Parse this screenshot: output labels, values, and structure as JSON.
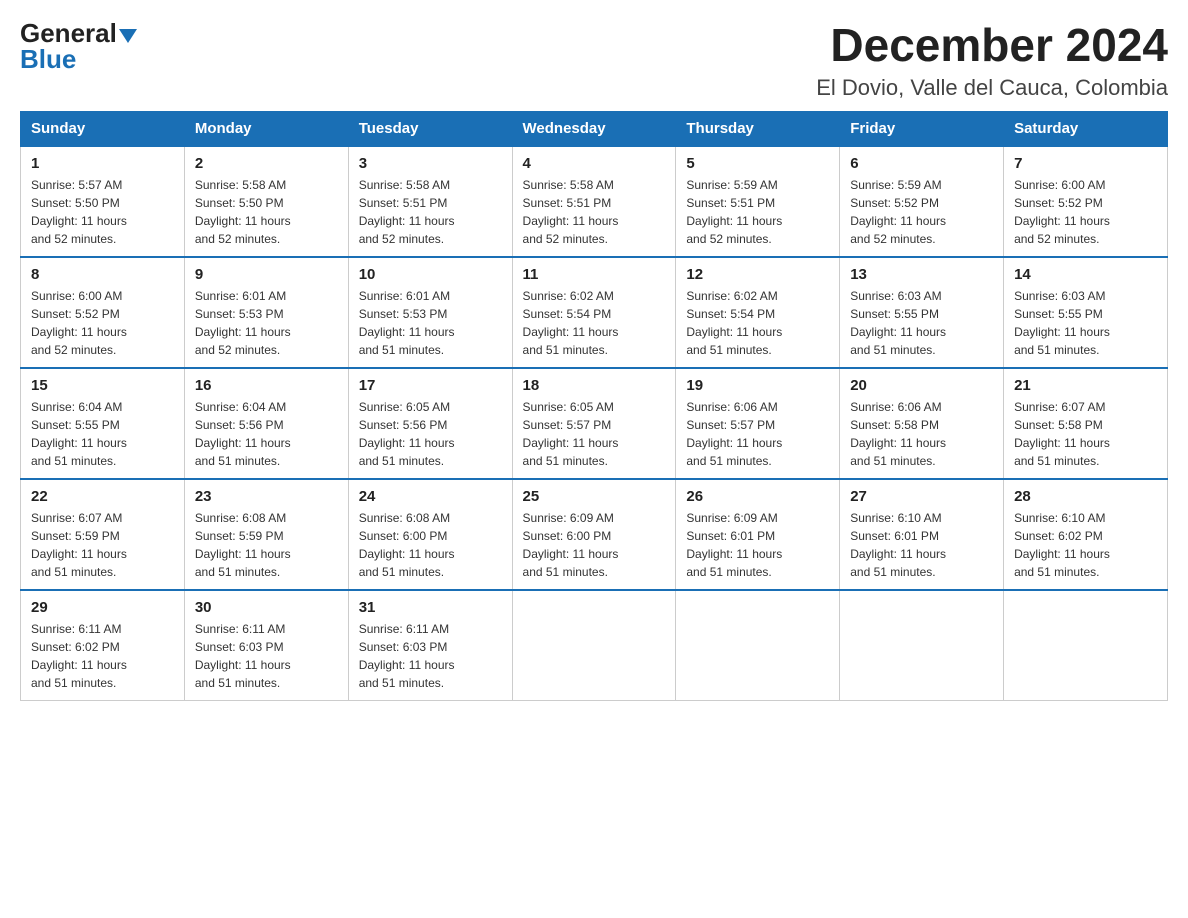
{
  "logo": {
    "general": "General",
    "blue": "Blue"
  },
  "title": "December 2024",
  "location": "El Dovio, Valle del Cauca, Colombia",
  "days_of_week": [
    "Sunday",
    "Monday",
    "Tuesday",
    "Wednesday",
    "Thursday",
    "Friday",
    "Saturday"
  ],
  "weeks": [
    [
      {
        "day": "1",
        "sunrise": "5:57 AM",
        "sunset": "5:50 PM",
        "daylight": "11 hours and 52 minutes."
      },
      {
        "day": "2",
        "sunrise": "5:58 AM",
        "sunset": "5:50 PM",
        "daylight": "11 hours and 52 minutes."
      },
      {
        "day": "3",
        "sunrise": "5:58 AM",
        "sunset": "5:51 PM",
        "daylight": "11 hours and 52 minutes."
      },
      {
        "day": "4",
        "sunrise": "5:58 AM",
        "sunset": "5:51 PM",
        "daylight": "11 hours and 52 minutes."
      },
      {
        "day": "5",
        "sunrise": "5:59 AM",
        "sunset": "5:51 PM",
        "daylight": "11 hours and 52 minutes."
      },
      {
        "day": "6",
        "sunrise": "5:59 AM",
        "sunset": "5:52 PM",
        "daylight": "11 hours and 52 minutes."
      },
      {
        "day": "7",
        "sunrise": "6:00 AM",
        "sunset": "5:52 PM",
        "daylight": "11 hours and 52 minutes."
      }
    ],
    [
      {
        "day": "8",
        "sunrise": "6:00 AM",
        "sunset": "5:52 PM",
        "daylight": "11 hours and 52 minutes."
      },
      {
        "day": "9",
        "sunrise": "6:01 AM",
        "sunset": "5:53 PM",
        "daylight": "11 hours and 52 minutes."
      },
      {
        "day": "10",
        "sunrise": "6:01 AM",
        "sunset": "5:53 PM",
        "daylight": "11 hours and 51 minutes."
      },
      {
        "day": "11",
        "sunrise": "6:02 AM",
        "sunset": "5:54 PM",
        "daylight": "11 hours and 51 minutes."
      },
      {
        "day": "12",
        "sunrise": "6:02 AM",
        "sunset": "5:54 PM",
        "daylight": "11 hours and 51 minutes."
      },
      {
        "day": "13",
        "sunrise": "6:03 AM",
        "sunset": "5:55 PM",
        "daylight": "11 hours and 51 minutes."
      },
      {
        "day": "14",
        "sunrise": "6:03 AM",
        "sunset": "5:55 PM",
        "daylight": "11 hours and 51 minutes."
      }
    ],
    [
      {
        "day": "15",
        "sunrise": "6:04 AM",
        "sunset": "5:55 PM",
        "daylight": "11 hours and 51 minutes."
      },
      {
        "day": "16",
        "sunrise": "6:04 AM",
        "sunset": "5:56 PM",
        "daylight": "11 hours and 51 minutes."
      },
      {
        "day": "17",
        "sunrise": "6:05 AM",
        "sunset": "5:56 PM",
        "daylight": "11 hours and 51 minutes."
      },
      {
        "day": "18",
        "sunrise": "6:05 AM",
        "sunset": "5:57 PM",
        "daylight": "11 hours and 51 minutes."
      },
      {
        "day": "19",
        "sunrise": "6:06 AM",
        "sunset": "5:57 PM",
        "daylight": "11 hours and 51 minutes."
      },
      {
        "day": "20",
        "sunrise": "6:06 AM",
        "sunset": "5:58 PM",
        "daylight": "11 hours and 51 minutes."
      },
      {
        "day": "21",
        "sunrise": "6:07 AM",
        "sunset": "5:58 PM",
        "daylight": "11 hours and 51 minutes."
      }
    ],
    [
      {
        "day": "22",
        "sunrise": "6:07 AM",
        "sunset": "5:59 PM",
        "daylight": "11 hours and 51 minutes."
      },
      {
        "day": "23",
        "sunrise": "6:08 AM",
        "sunset": "5:59 PM",
        "daylight": "11 hours and 51 minutes."
      },
      {
        "day": "24",
        "sunrise": "6:08 AM",
        "sunset": "6:00 PM",
        "daylight": "11 hours and 51 minutes."
      },
      {
        "day": "25",
        "sunrise": "6:09 AM",
        "sunset": "6:00 PM",
        "daylight": "11 hours and 51 minutes."
      },
      {
        "day": "26",
        "sunrise": "6:09 AM",
        "sunset": "6:01 PM",
        "daylight": "11 hours and 51 minutes."
      },
      {
        "day": "27",
        "sunrise": "6:10 AM",
        "sunset": "6:01 PM",
        "daylight": "11 hours and 51 minutes."
      },
      {
        "day": "28",
        "sunrise": "6:10 AM",
        "sunset": "6:02 PM",
        "daylight": "11 hours and 51 minutes."
      }
    ],
    [
      {
        "day": "29",
        "sunrise": "6:11 AM",
        "sunset": "6:02 PM",
        "daylight": "11 hours and 51 minutes."
      },
      {
        "day": "30",
        "sunrise": "6:11 AM",
        "sunset": "6:03 PM",
        "daylight": "11 hours and 51 minutes."
      },
      {
        "day": "31",
        "sunrise": "6:11 AM",
        "sunset": "6:03 PM",
        "daylight": "11 hours and 51 minutes."
      },
      null,
      null,
      null,
      null
    ]
  ],
  "labels": {
    "sunrise": "Sunrise:",
    "sunset": "Sunset:",
    "daylight": "Daylight:"
  }
}
